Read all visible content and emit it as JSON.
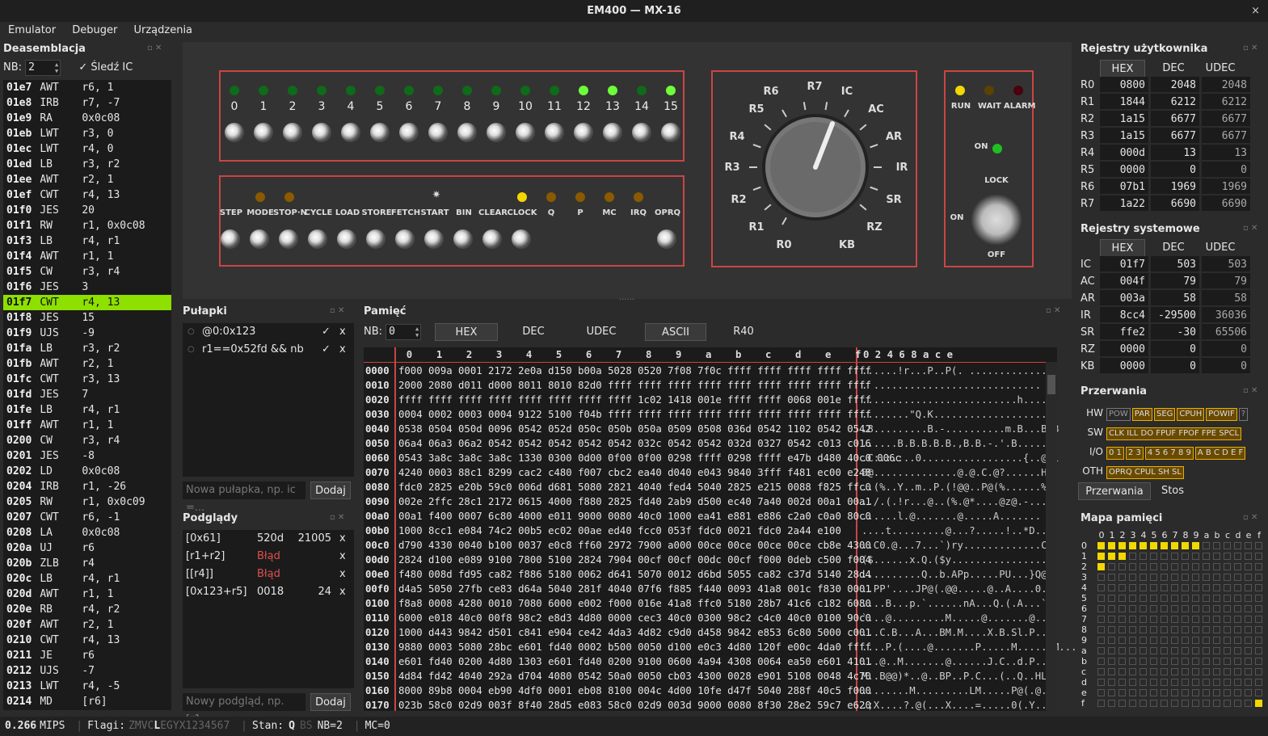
{
  "window": {
    "title": "EM400 — MX-16",
    "close": "×"
  },
  "menu": [
    "Emulator",
    "Debuger",
    "Urządzenia"
  ],
  "disasm": {
    "title": "Deasemblacja",
    "nb_label": "NB:",
    "nb_value": "2",
    "track_label": "✓ Śledź IC",
    "rows": [
      [
        "01e7",
        "AWT",
        "r6, 1"
      ],
      [
        "01e8",
        "IRB",
        "r7, -7"
      ],
      [
        "01e9",
        "RA",
        "0x0c08"
      ],
      [
        "01eb",
        "LWT",
        "r3, 0"
      ],
      [
        "01ec",
        "LWT",
        "r4, 0"
      ],
      [
        "01ed",
        "LB",
        "r3, r2"
      ],
      [
        "01ee",
        "AWT",
        "r2, 1"
      ],
      [
        "01ef",
        "CWT",
        "r4, 13"
      ],
      [
        "01f0",
        "JES",
        "20"
      ],
      [
        "01f1",
        "RW",
        "r1, 0x0c08"
      ],
      [
        "01f3",
        "LB",
        "r4, r1"
      ],
      [
        "01f4",
        "AWT",
        "r1, 1"
      ],
      [
        "01f5",
        "CW",
        "r3, r4"
      ],
      [
        "01f6",
        "JES",
        "3"
      ],
      [
        "01f7",
        "CWT",
        "r4, 13"
      ],
      [
        "01f8",
        "JES",
        "15"
      ],
      [
        "01f9",
        "UJS",
        "-9"
      ],
      [
        "01fa",
        "LB",
        "r3, r2"
      ],
      [
        "01fb",
        "AWT",
        "r2, 1"
      ],
      [
        "01fc",
        "CWT",
        "r3, 13"
      ],
      [
        "01fd",
        "JES",
        "7"
      ],
      [
        "01fe",
        "LB",
        "r4, r1"
      ],
      [
        "01ff",
        "AWT",
        "r1, 1"
      ],
      [
        "0200",
        "CW",
        "r3, r4"
      ],
      [
        "0201",
        "JES",
        "-8"
      ],
      [
        "0202",
        "LD",
        "0x0c08"
      ],
      [
        "0204",
        "IRB",
        "r1, -26"
      ],
      [
        "0205",
        "RW",
        "r1, 0x0c09"
      ],
      [
        "0207",
        "CWT",
        "r6, -1"
      ],
      [
        "0208",
        "LA",
        "0x0c08"
      ],
      [
        "020a",
        "UJ",
        "r6"
      ],
      [
        "020b",
        "ZLB",
        "r4"
      ],
      [
        "020c",
        "LB",
        "r4, r1"
      ],
      [
        "020d",
        "AWT",
        "r1, 1"
      ],
      [
        "020e",
        "RB",
        "r4, r2"
      ],
      [
        "020f",
        "AWT",
        "r2, 1"
      ],
      [
        "0210",
        "CWT",
        "r4, 13"
      ],
      [
        "0211",
        "JE",
        "r6"
      ],
      [
        "0212",
        "UJS",
        "-7"
      ],
      [
        "0213",
        "LWT",
        "r4, -5"
      ],
      [
        "0214",
        "MD",
        "[r6]"
      ]
    ],
    "selected_index": 14
  },
  "panel": {
    "bits": [
      "0",
      "1",
      "2",
      "3",
      "4",
      "5",
      "6",
      "7",
      "8",
      "9",
      "10",
      "11",
      "12",
      "13",
      "14",
      "15"
    ],
    "bit_leds_on": [
      12,
      13,
      15
    ],
    "controls": [
      "STEP",
      "MODE",
      "STOP·N",
      "CYCLE",
      "LOAD",
      "STORE",
      "FETCH",
      "START",
      "BIN",
      "CLEAR",
      "CLOCK",
      "Q",
      "P",
      "MC",
      "IRQ",
      "OPRQ"
    ],
    "rotary_labels": [
      "R6",
      "R7",
      "IC",
      "AC",
      "AR",
      "IR",
      "SR",
      "RZ",
      "KB",
      "R0",
      "R1",
      "R2",
      "R3",
      "R4",
      "R5"
    ],
    "status_leds": [
      "RUN",
      "WAIT",
      "ALARM"
    ],
    "on_label": "ON",
    "lock_label": "LOCK",
    "off_label": "OFF",
    "on2_label": "ON",
    "colors": {
      "led_green": "#1fbf1f",
      "led_yellow": "#f2d800",
      "led_amber": "#8a5a00",
      "frame": "#c44444"
    }
  },
  "traps": {
    "title": "Pułapki",
    "items": [
      {
        "expr": "@0:0x123",
        "check": "✓",
        "del": "x"
      },
      {
        "expr": "r1==0x52fd && nb",
        "check": "✓",
        "del": "x"
      }
    ],
    "placeholder": "Nowa pułapka, np. ic =...",
    "add": "Dodaj"
  },
  "watches": {
    "title": "Podglądy",
    "items": [
      {
        "expr": "[0x61]",
        "a": "520d",
        "b": "21005",
        "del": "x",
        "err": false
      },
      {
        "expr": "[r1+r2]",
        "a": "Błąd",
        "b": "",
        "del": "x",
        "err": true
      },
      {
        "expr": "[[r4]]",
        "a": "Błąd",
        "b": "",
        "del": "x",
        "err": true
      },
      {
        "expr": "[0x123+r5]",
        "a": "0018",
        "b": "24",
        "del": "x",
        "err": false
      }
    ],
    "placeholder": "Nowy podgląd, np. [r1...",
    "add": "Dodaj"
  },
  "memory": {
    "title": "Pamięć",
    "nb_label": "NB:",
    "nb_value": "0",
    "tabs": [
      "HEX",
      "DEC",
      "UDEC",
      "ASCII",
      "R40"
    ],
    "col_header": "  0    1    2    3    4    5    6    7    8    9    a    b    c    d    e    f  ",
    "ascii_header": "0 2 4 6 8 a c e",
    "rows": [
      [
        "0000",
        "f000 009a 0001 2172 2e0a d150 b00a 5028 0520 7f08 7f0c ffff ffff ffff ffff ffff",
        "......!r...P..P(. .............."
      ],
      [
        "0010",
        "2000 2080 d011 d000 8011 8010 82d0 ffff ffff ffff ffff ffff ffff ffff ffff ffff",
        ". ............................"
      ],
      [
        "0020",
        "ffff ffff ffff ffff ffff ffff ffff ffff 1c02 1418 001e ffff ffff 0068 001e ffff",
        "..........................h...."
      ],
      [
        "0030",
        "0004 0002 0003 0004 9122 5100 f04b ffff ffff ffff ffff ffff ffff ffff ffff ffff",
        "........\"Q.K..................."
      ],
      [
        "0040",
        "0538 0504 050d 0096 0542 052d 050c 050b 050a 0509 0508 036d 0542 1102 0542 0542",
        ".8.........B.-..........m.B...B.B"
      ],
      [
        "0050",
        "06a4 06a3 06a2 0542 0542 0542 0542 0542 032c 0542 0542 032d 0327 0542 c013 c016",
        "......B.B.B.B.B.,B.B.-.'.B....."
      ],
      [
        "0060",
        "0543 3a8c 3a8c 3a8c 1330 0300 0d00 0f00 0f00 0298 ffff 0298 ffff e47b d480 40c0 006c",
        ".C:.:.:..0.................{..@.l"
      ],
      [
        "0070",
        "4240 0003 88c1 8299 cac2 c480 f007 cbc2 ea40 d040 e043 9840 3fff f481 ec00 e248",
        "B@..............@.@.C.@?......H"
      ],
      [
        "0080",
        "fdc0 2825 e20b 59c0 006d d681 5080 2821 4040 fed4 5040 2825 e215 0088 f825 ffc0",
        "..(%..Y..m..P.(!@@..P@(%......%.."
      ],
      [
        "0090",
        "002e 2ffc 28c1 2172 0615 4000 f880 2825 fd40 2ab9 d500 ec40 7a40 002d 00a1 00a1",
        "../.(.!r...@..(%.@*....@z@.-...."
      ],
      [
        "00a0",
        "00a1 f400 0007 6c80 4000 e011 9000 0080 40c0 1000 ea41 e881 e886 c2a0 c0a0 80c0",
        "......l.@.......@.....A......."
      ],
      [
        "00b0",
        "1000 8cc1 e084 74c2 00b5 ec02 00ae ed40 fcc0 053f fdc0 0021 fdc0 2a44 e100",
        "....t.........@...?.....!..*D.."
      ],
      [
        "00c0",
        "d790 4330 0040 b100 0037 e0c8 ff60 2972 7900 a000 00ce 00ce 00ce 00ce cb8e 4300",
        "..C0.@...7...`)ry.............C."
      ],
      [
        "00d0",
        "2824 d100 e089 9100 7800 5100 2824 7904 00cf 00cf 00dc 00cf f000 0deb c500 f004",
        "($......x.Q.($y................"
      ],
      [
        "00e0",
        "f480 008d fd95 ca82 f886 5180 0062 d641 5070 0012 d6bd 5055 ca82 c37d 5140 28d4",
        "..........Q..b.APp.....PU...}Q@(."
      ],
      [
        "00f0",
        "d4a5 5050 27fb ce83 d64a 5040 281f 4040 07f6 f885 f440 0093 41a8 001c f830 0001",
        "..PP'....JP@(.@@.....@..A....0.."
      ],
      [
        "0100",
        "f8a8 0008 4280 0010 7080 6000 e002 f000 016e 41a8 ffc0 5180 28b7 41c6 c182 6080",
        "....B...p.`......nA...Q.(.A...`."
      ],
      [
        "0110",
        "6000 e018 40c0 00f8 98c2 e8d3 4d80 0000 cec3 40c0 0300 98c2 c4c0 40c0 0100 90c0",
        "`...@.........M.....@.......@...."
      ],
      [
        "0120",
        "1000 d443 9842 d501 c841 e904 ce42 4da3 4d82 c9d0 d458 9842 e853 6c80 5000 c001",
        "...C.B...A...BM.M....X.B.Sl.P...."
      ],
      [
        "0130",
        "9880 0003 5080 28bc e601 fd40 0002 b500 0050 d100 e0c3 4d80 120f e00c 4da0 ffff",
        "....P.(....@.......P.....M......M..."
      ],
      [
        "0140",
        "e601 fd40 0200 4d80 1303 e601 fd40 0200 9100 0600 4a94 4308 0064 ea50 e601 4101",
        "...@..M.......@......J.C..d.P..A."
      ],
      [
        "0150",
        "4d84 fd42 4040 292a d704 4080 0542 50a0 0050 cb03 4300 0028 e901 5108 0048 4c70",
        "M..B@@)*..@..BP..P.C...(..Q..HLp"
      ],
      [
        "0160",
        "8000 89b8 0004 eb90 4df0 0001 eb08 8100 004c 4d00 10fe d47f 5040 288f 40c5 f000",
        "........M.........LM.....P@(.@..."
      ],
      [
        "0170",
        "023b 58c0 02d9 003f 8f40 28d5 e083 58c0 02d9 003d 9000 0080 8f30 28e2 59c7 e620",
        ".;X....?.@(...X....=.....0(.Y.. "
      ]
    ]
  },
  "user_regs": {
    "title": "Rejestry użytkownika",
    "cols": [
      "HEX",
      "DEC",
      "UDEC"
    ],
    "rows": [
      [
        "R0",
        "0800",
        "2048",
        "2048"
      ],
      [
        "R1",
        "1844",
        "6212",
        "6212"
      ],
      [
        "R2",
        "1a15",
        "6677",
        "6677"
      ],
      [
        "R3",
        "1a15",
        "6677",
        "6677"
      ],
      [
        "R4",
        "000d",
        "13",
        "13"
      ],
      [
        "R5",
        "0000",
        "0",
        "0"
      ],
      [
        "R6",
        "07b1",
        "1969",
        "1969"
      ],
      [
        "R7",
        "1a22",
        "6690",
        "6690"
      ]
    ]
  },
  "sys_regs": {
    "title": "Rejestry systemowe",
    "cols": [
      "HEX",
      "DEC",
      "UDEC"
    ],
    "rows": [
      [
        "IC",
        "01f7",
        "503",
        "503"
      ],
      [
        "AC",
        "004f",
        "79",
        "79"
      ],
      [
        "AR",
        "003a",
        "58",
        "58"
      ],
      [
        "IR",
        "8cc4",
        "-29500",
        "36036"
      ],
      [
        "SR",
        "ffe2",
        "-30",
        "65506"
      ],
      [
        "RZ",
        "0000",
        "0",
        "0"
      ],
      [
        "KB",
        "0000",
        "0",
        "0"
      ]
    ]
  },
  "interrupts": {
    "title": "Przerwania",
    "groups": [
      {
        "label": "HW",
        "items": [
          [
            "POW",
            "off"
          ],
          [
            "PAR",
            "y"
          ],
          [
            "SEG",
            "y"
          ],
          [
            "CPUH",
            "y"
          ],
          [
            "POWIF",
            "y"
          ],
          [
            "?",
            "off"
          ]
        ]
      },
      {
        "label": "SW",
        "items": [
          [
            "CLK ILL DO FPUF FPOF FPE SPCL",
            "y"
          ]
        ]
      },
      {
        "label": "I/O",
        "items": [
          [
            "0 1",
            "y"
          ],
          [
            "2 3",
            "y"
          ],
          [
            "4 5 6 7 8 9",
            "y"
          ],
          [
            "A B C D E F",
            "y"
          ]
        ]
      },
      {
        "label": "OTH",
        "items": [
          [
            "OPRQ CPUL SH SL",
            "y"
          ]
        ]
      }
    ],
    "tabs": [
      "Przerwania",
      "Stos"
    ]
  },
  "memmap": {
    "title": "Mapa pamięci",
    "cols": [
      "0",
      "1",
      "2",
      "3",
      "4",
      "5",
      "6",
      "7",
      "8",
      "9",
      "a",
      "b",
      "c",
      "d",
      "e",
      "f"
    ],
    "rows": [
      "0",
      "1",
      "2",
      "3",
      "4",
      "5",
      "6",
      "7",
      "8",
      "9",
      "a",
      "b",
      "c",
      "d",
      "e",
      "f"
    ],
    "filled": {
      "0": [
        0,
        1,
        2,
        3,
        4,
        5,
        6,
        7,
        8,
        9
      ],
      "1": [
        0,
        1,
        2
      ],
      "2": [
        0
      ],
      "f": [
        15
      ]
    }
  },
  "status": {
    "mips": "0.266",
    "mips_unit": "MIPS",
    "flags_label": "Flagi:",
    "flags_dim": "ZMVC",
    "flags_on": "L",
    "flags_rest": "EGYX1234567",
    "state_label": "Stan:",
    "state": "Q",
    "bs": "BS",
    "nb": "NB=2",
    "mc": "MC=0"
  }
}
